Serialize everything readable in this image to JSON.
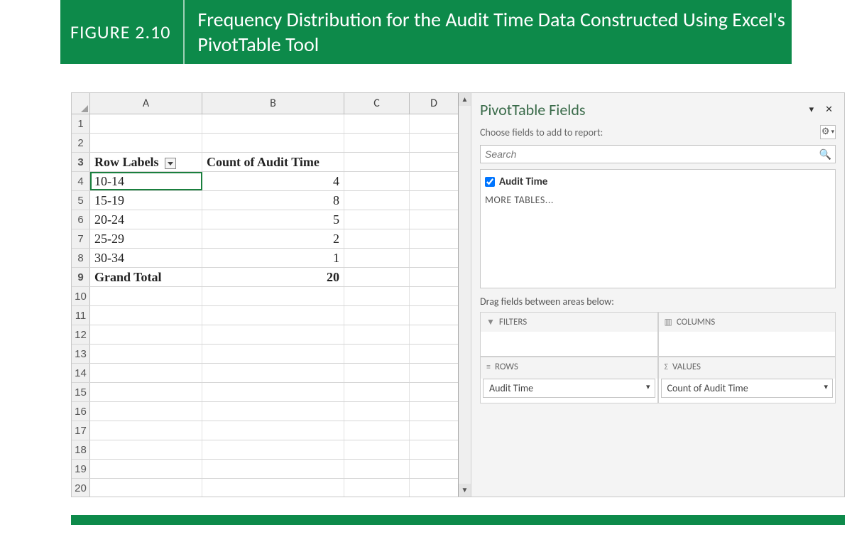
{
  "figure": {
    "label": "FIGURE 2.10",
    "title": "Frequency Distribution for the Audit Time Data Constructed Using Excel's PivotTable Tool"
  },
  "sheet": {
    "columns": [
      "A",
      "B",
      "C",
      "D"
    ],
    "row_numbers": [
      "1",
      "2",
      "3",
      "4",
      "5",
      "6",
      "7",
      "8",
      "9",
      "10",
      "11",
      "12",
      "13",
      "14",
      "15",
      "16",
      "17",
      "18",
      "19",
      "20"
    ],
    "header": {
      "row_labels_label": "Row Labels",
      "count_label": "Count of Audit Time"
    },
    "data_rows": [
      {
        "label": "10-14",
        "count": "4"
      },
      {
        "label": "15-19",
        "count": "8"
      },
      {
        "label": "20-24",
        "count": "5"
      },
      {
        "label": "25-29",
        "count": "2"
      },
      {
        "label": "30-34",
        "count": "1"
      }
    ],
    "grand_total": {
      "label": "Grand Total",
      "count": "20"
    }
  },
  "pane": {
    "title": "PivotTable Fields",
    "subtitle": "Choose fields to add to report:",
    "search_placeholder": "Search",
    "field_audit_time": "Audit Time",
    "more_tables": "MORE TABLES...",
    "drag_label": "Drag fields between areas below:",
    "areas": {
      "filters": "FILTERS",
      "columns": "COLUMNS",
      "rows": "ROWS",
      "values": "VALUES"
    },
    "chips": {
      "rows": "Audit Time",
      "values": "Count of Audit Time"
    }
  },
  "chart_data": {
    "type": "table",
    "title": "Frequency Distribution for the Audit Time Data",
    "columns": [
      "Row Labels",
      "Count of Audit Time"
    ],
    "rows": [
      [
        "10-14",
        4
      ],
      [
        "15-19",
        8
      ],
      [
        "20-24",
        5
      ],
      [
        "25-29",
        2
      ],
      [
        "30-34",
        1
      ]
    ],
    "total": [
      "Grand Total",
      20
    ]
  }
}
